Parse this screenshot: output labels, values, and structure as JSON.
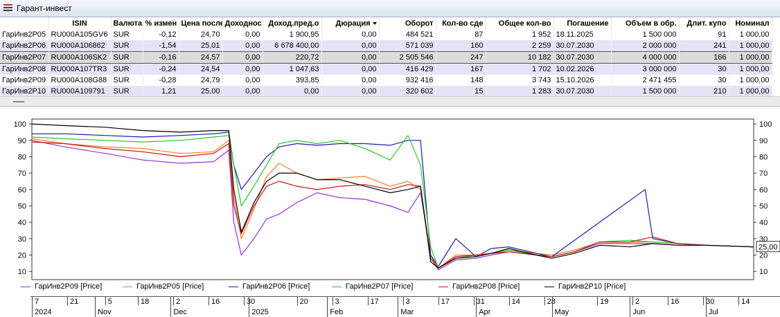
{
  "window": {
    "title": "Гарант-инвест"
  },
  "table": {
    "columns": [
      "",
      "ISIN",
      "Валюта",
      "% измен",
      "Цена после",
      "Доходнос",
      "Доход.пред.о",
      "Дюрация",
      "Оборот",
      "Кол-во сде",
      "Общее кол-во",
      "Погашение",
      "Объем в обр.",
      "Длит. купо",
      "Номинал"
    ],
    "rows": [
      [
        "ГарИнв2P05",
        "RU000A105GV6",
        "SUR",
        "-0,12",
        "24,70",
        "0,00",
        "1 900,95",
        "0,00",
        "484 521",
        "87",
        "1 952",
        "18.11.2025",
        "1 500 000",
        "91",
        "1 000,00"
      ],
      [
        "ГарИнв2P06",
        "RU000A106862",
        "SUR",
        "-1,54",
        "25,01",
        "0,00",
        "6 678 400,00",
        "0,00",
        "571 039",
        "160",
        "2 259",
        "30.07.2030",
        "2 000 000",
        "241",
        "1 000,00"
      ],
      [
        "ГарИнв2P07",
        "RU000A106SK2",
        "SUR",
        "-0,16",
        "24,57",
        "0,00",
        "220,72",
        "0,00",
        "2 505 546",
        "247",
        "10 182",
        "30.07.2030",
        "4 000 000",
        "166",
        "1 000,00"
      ],
      [
        "ГарИнв2P08",
        "RU000A107TR3",
        "SUR",
        "-0,24",
        "24,54",
        "0,00",
        "1 047,63",
        "0,00",
        "416 429",
        "167",
        "1 702",
        "10.02.2026",
        "3 000 000",
        "30",
        "1 000,00"
      ],
      [
        "ГарИнв2P09",
        "RU000A108G88",
        "SUR",
        "-0,28",
        "24,79",
        "0,00",
        "393,85",
        "0,00",
        "932 416",
        "148",
        "3 743",
        "15.10.2026",
        "2 471 455",
        "30",
        "1 000,00"
      ],
      [
        "ГарИнв2P10",
        "RU000A109791",
        "SUR",
        "1,21",
        "25,00",
        "0,00",
        "0,00",
        "0,00",
        "320 602",
        "15",
        "1 283",
        "30.07.2030",
        "1 500 000",
        "210",
        "1 000,00"
      ]
    ],
    "selected_row": 2
  },
  "chart_data": {
    "type": "line",
    "ylim": [
      5,
      103
    ],
    "yticks": [
      10,
      20,
      30,
      40,
      50,
      60,
      70,
      80,
      90,
      100
    ],
    "last_value_label": "25,00",
    "x_range": [
      "2024-10-07",
      "2025-07-20"
    ],
    "day_ticks": [
      {
        "date": "2024-10-07",
        "label": "7"
      },
      {
        "date": "2024-10-21",
        "label": "21"
      },
      {
        "date": "2024-11-05",
        "label": "5"
      },
      {
        "date": "2024-11-18",
        "label": "18"
      },
      {
        "date": "2024-12-02",
        "label": "2"
      },
      {
        "date": "2024-12-16",
        "label": "16"
      },
      {
        "date": "2024-12-30",
        "label": "30"
      },
      {
        "date": "2025-01-20",
        "label": "20"
      },
      {
        "date": "2025-02-03",
        "label": "3"
      },
      {
        "date": "2025-02-17",
        "label": "17"
      },
      {
        "date": "2025-03-03",
        "label": "3"
      },
      {
        "date": "2025-03-17",
        "label": "17"
      },
      {
        "date": "2025-03-31",
        "label": "31"
      },
      {
        "date": "2025-04-14",
        "label": "14"
      },
      {
        "date": "2025-04-28",
        "label": "28"
      },
      {
        "date": "2025-05-19",
        "label": "19"
      },
      {
        "date": "2025-06-02",
        "label": "2"
      },
      {
        "date": "2025-06-16",
        "label": "16"
      },
      {
        "date": "2025-06-30",
        "label": "30"
      },
      {
        "date": "2025-07-14",
        "label": "14"
      }
    ],
    "month_ticks": [
      {
        "date": "2024-10-07",
        "label": "2024"
      },
      {
        "date": "2024-11-01",
        "label": "Nov"
      },
      {
        "date": "2024-12-01",
        "label": "Dec"
      },
      {
        "date": "2025-01-01",
        "label": "2025"
      },
      {
        "date": "2025-02-01",
        "label": "Feb"
      },
      {
        "date": "2025-03-01",
        "label": "Mar"
      },
      {
        "date": "2025-04-01",
        "label": "Apr"
      },
      {
        "date": "2025-05-01",
        "label": "May"
      },
      {
        "date": "2025-06-01",
        "label": "Jun"
      },
      {
        "date": "2025-07-01",
        "label": "Jul"
      }
    ],
    "series": [
      {
        "name": "ГарИнв2P09 [Price]",
        "color": "#9b30d9",
        "points": [
          [
            "2024-10-07",
            90
          ],
          [
            "2024-10-20",
            86
          ],
          [
            "2024-11-05",
            82
          ],
          [
            "2024-11-20",
            78
          ],
          [
            "2024-12-05",
            76
          ],
          [
            "2024-12-18",
            77
          ],
          [
            "2024-12-24",
            84
          ],
          [
            "2024-12-26",
            40
          ],
          [
            "2024-12-29",
            20
          ],
          [
            "2025-01-03",
            30
          ],
          [
            "2025-01-08",
            42
          ],
          [
            "2025-01-13",
            45
          ],
          [
            "2025-01-20",
            52
          ],
          [
            "2025-01-28",
            58
          ],
          [
            "2025-02-06",
            55
          ],
          [
            "2025-02-16",
            54
          ],
          [
            "2025-02-26",
            50
          ],
          [
            "2025-03-05",
            46
          ],
          [
            "2025-03-10",
            58
          ],
          [
            "2025-03-14",
            20
          ],
          [
            "2025-03-17",
            11
          ],
          [
            "2025-03-24",
            17
          ],
          [
            "2025-04-01",
            18
          ],
          [
            "2025-04-07",
            20
          ],
          [
            "2025-04-14",
            22
          ],
          [
            "2025-04-25",
            20
          ],
          [
            "2025-05-01",
            19
          ],
          [
            "2025-05-10",
            22
          ],
          [
            "2025-05-20",
            27
          ],
          [
            "2025-06-01",
            27
          ],
          [
            "2025-06-10",
            27
          ],
          [
            "2025-06-20",
            26
          ],
          [
            "2025-07-01",
            26
          ],
          [
            "2025-07-20",
            25
          ]
        ]
      },
      {
        "name": "ГарИнв2P05 [Price]",
        "color": "#f08020",
        "points": [
          [
            "2024-10-07",
            91
          ],
          [
            "2024-10-20",
            88
          ],
          [
            "2024-11-05",
            86
          ],
          [
            "2024-11-20",
            85
          ],
          [
            "2024-12-05",
            82
          ],
          [
            "2024-12-18",
            83
          ],
          [
            "2024-12-24",
            90
          ],
          [
            "2024-12-26",
            55
          ],
          [
            "2024-12-29",
            30
          ],
          [
            "2025-01-03",
            48
          ],
          [
            "2025-01-08",
            68
          ],
          [
            "2025-01-13",
            76
          ],
          [
            "2025-01-20",
            70
          ],
          [
            "2025-01-28",
            66
          ],
          [
            "2025-02-06",
            67
          ],
          [
            "2025-02-16",
            68
          ],
          [
            "2025-02-26",
            62
          ],
          [
            "2025-03-05",
            65
          ],
          [
            "2025-03-10",
            60
          ],
          [
            "2025-03-14",
            20
          ],
          [
            "2025-03-17",
            12
          ],
          [
            "2025-03-24",
            20
          ],
          [
            "2025-04-01",
            20
          ],
          [
            "2025-04-07",
            21
          ],
          [
            "2025-04-14",
            23
          ],
          [
            "2025-04-25",
            21
          ],
          [
            "2025-05-01",
            20
          ],
          [
            "2025-05-10",
            23
          ],
          [
            "2025-05-20",
            28
          ],
          [
            "2025-06-01",
            28
          ],
          [
            "2025-06-10",
            28
          ],
          [
            "2025-06-20",
            27
          ],
          [
            "2025-07-01",
            26
          ],
          [
            "2025-07-20",
            25
          ]
        ]
      },
      {
        "name": "ГарИнв2P06 [Price]",
        "color": "#1a1aa8",
        "points": [
          [
            "2024-10-07",
            94
          ],
          [
            "2024-10-20",
            94
          ],
          [
            "2024-11-05",
            93
          ],
          [
            "2024-11-20",
            92
          ],
          [
            "2024-12-05",
            93
          ],
          [
            "2024-12-18",
            94
          ],
          [
            "2024-12-24",
            95
          ],
          [
            "2024-12-26",
            75
          ],
          [
            "2024-12-29",
            60
          ],
          [
            "2025-01-03",
            70
          ],
          [
            "2025-01-08",
            80
          ],
          [
            "2025-01-13",
            86
          ],
          [
            "2025-01-20",
            88
          ],
          [
            "2025-01-28",
            87
          ],
          [
            "2025-02-06",
            88
          ],
          [
            "2025-02-16",
            88
          ],
          [
            "2025-02-26",
            87
          ],
          [
            "2025-03-05",
            90
          ],
          [
            "2025-03-10",
            90
          ],
          [
            "2025-03-14",
            20
          ],
          [
            "2025-03-17",
            13
          ],
          [
            "2025-03-24",
            30
          ],
          [
            "2025-04-01",
            19
          ],
          [
            "2025-04-07",
            24
          ],
          [
            "2025-04-14",
            25
          ],
          [
            "2025-04-25",
            21
          ],
          [
            "2025-05-01",
            19
          ],
          [
            "2025-06-07",
            60
          ],
          [
            "2025-06-10",
            30
          ],
          [
            "2025-06-20",
            27
          ],
          [
            "2025-07-01",
            26
          ],
          [
            "2025-07-20",
            25
          ]
        ]
      },
      {
        "name": "ГарИнв2P07 [Price]",
        "color": "#22cc22",
        "points": [
          [
            "2024-10-07",
            92
          ],
          [
            "2024-10-20",
            91
          ],
          [
            "2024-11-05",
            90
          ],
          [
            "2024-11-20",
            89
          ],
          [
            "2024-12-05",
            90
          ],
          [
            "2024-12-18",
            92
          ],
          [
            "2024-12-24",
            93
          ],
          [
            "2024-12-26",
            75
          ],
          [
            "2024-12-29",
            50
          ],
          [
            "2025-01-03",
            62
          ],
          [
            "2025-01-08",
            75
          ],
          [
            "2025-01-13",
            88
          ],
          [
            "2025-01-20",
            90
          ],
          [
            "2025-01-28",
            88
          ],
          [
            "2025-02-06",
            90
          ],
          [
            "2025-02-16",
            85
          ],
          [
            "2025-02-26",
            78
          ],
          [
            "2025-03-05",
            93
          ],
          [
            "2025-03-10",
            75
          ],
          [
            "2025-03-14",
            25
          ],
          [
            "2025-03-17",
            12
          ],
          [
            "2025-03-24",
            18
          ],
          [
            "2025-04-01",
            20
          ],
          [
            "2025-04-07",
            21
          ],
          [
            "2025-04-14",
            23
          ],
          [
            "2025-04-25",
            20
          ],
          [
            "2025-05-01",
            19
          ],
          [
            "2025-05-10",
            22
          ],
          [
            "2025-05-20",
            28
          ],
          [
            "2025-06-01",
            29
          ],
          [
            "2025-06-10",
            28
          ],
          [
            "2025-06-20",
            27
          ],
          [
            "2025-07-01",
            26
          ],
          [
            "2025-07-20",
            25
          ]
        ]
      },
      {
        "name": "ГарИнв2P08 [Price]",
        "color": "#cc1111",
        "points": [
          [
            "2024-10-07",
            89
          ],
          [
            "2024-10-20",
            88
          ],
          [
            "2024-11-05",
            85
          ],
          [
            "2024-11-20",
            83
          ],
          [
            "2024-12-05",
            80
          ],
          [
            "2024-12-18",
            82
          ],
          [
            "2024-12-24",
            88
          ],
          [
            "2024-12-26",
            50
          ],
          [
            "2024-12-29",
            33
          ],
          [
            "2025-01-03",
            50
          ],
          [
            "2025-01-08",
            62
          ],
          [
            "2025-01-13",
            65
          ],
          [
            "2025-01-20",
            62
          ],
          [
            "2025-01-28",
            60
          ],
          [
            "2025-02-06",
            62
          ],
          [
            "2025-02-16",
            63
          ],
          [
            "2025-02-26",
            60
          ],
          [
            "2025-03-05",
            63
          ],
          [
            "2025-03-10",
            62
          ],
          [
            "2025-03-14",
            18
          ],
          [
            "2025-03-17",
            12
          ],
          [
            "2025-03-24",
            19
          ],
          [
            "2025-04-01",
            20
          ],
          [
            "2025-04-07",
            21
          ],
          [
            "2025-04-14",
            22
          ],
          [
            "2025-04-25",
            20
          ],
          [
            "2025-05-01",
            19
          ],
          [
            "2025-05-10",
            22
          ],
          [
            "2025-05-20",
            28
          ],
          [
            "2025-06-01",
            28
          ],
          [
            "2025-06-10",
            31
          ],
          [
            "2025-06-20",
            27
          ],
          [
            "2025-07-01",
            26
          ],
          [
            "2025-07-20",
            25
          ]
        ]
      },
      {
        "name": "ГарИнв2P10 [Price]",
        "color": "#000000",
        "points": [
          [
            "2024-10-07",
            100
          ],
          [
            "2024-10-20",
            99
          ],
          [
            "2024-11-05",
            98
          ],
          [
            "2024-11-20",
            96
          ],
          [
            "2024-12-05",
            95
          ],
          [
            "2024-12-18",
            96
          ],
          [
            "2024-12-24",
            96
          ],
          [
            "2024-12-26",
            60
          ],
          [
            "2024-12-29",
            34
          ],
          [
            "2025-01-03",
            52
          ],
          [
            "2025-01-08",
            65
          ],
          [
            "2025-01-13",
            70
          ],
          [
            "2025-01-20",
            70
          ],
          [
            "2025-01-28",
            66
          ],
          [
            "2025-02-06",
            66
          ],
          [
            "2025-02-16",
            62
          ],
          [
            "2025-02-26",
            58
          ],
          [
            "2025-03-05",
            60
          ],
          [
            "2025-03-10",
            62
          ],
          [
            "2025-03-14",
            16
          ],
          [
            "2025-03-17",
            12
          ],
          [
            "2025-03-24",
            18
          ],
          [
            "2025-04-01",
            19
          ],
          [
            "2025-04-07",
            21
          ],
          [
            "2025-04-14",
            24
          ],
          [
            "2025-04-25",
            20
          ],
          [
            "2025-05-01",
            18
          ],
          [
            "2025-05-10",
            21
          ],
          [
            "2025-05-20",
            26
          ],
          [
            "2025-06-01",
            25
          ],
          [
            "2025-06-10",
            27
          ],
          [
            "2025-06-20",
            26
          ],
          [
            "2025-07-01",
            26
          ],
          [
            "2025-07-20",
            25
          ]
        ]
      }
    ]
  }
}
